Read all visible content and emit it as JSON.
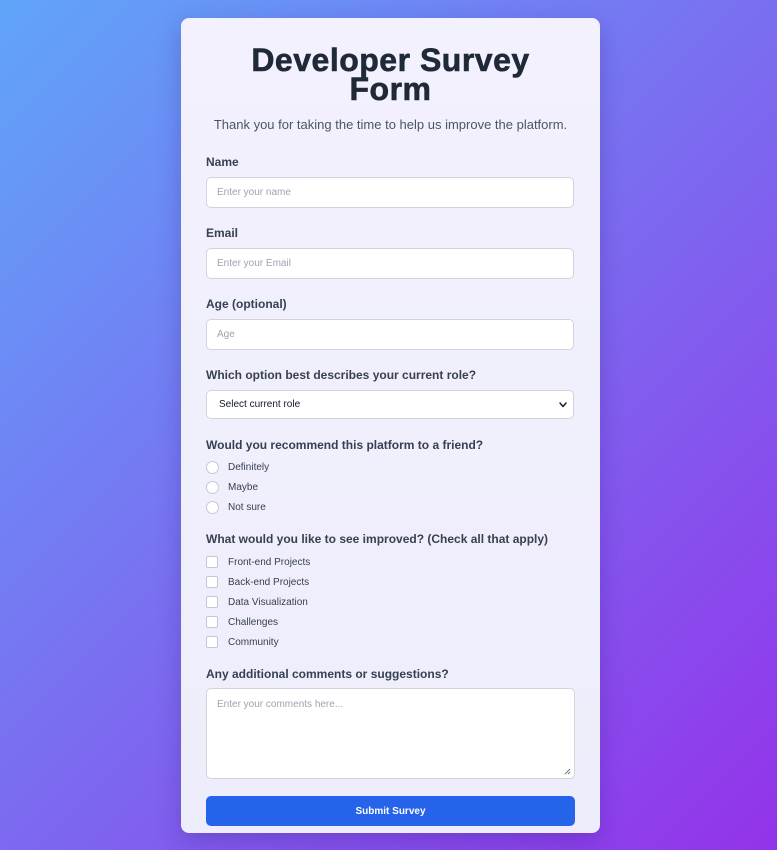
{
  "form": {
    "title": "Developer Survey Form",
    "subtitle": "Thank you for taking the time to help us improve the platform.",
    "name": {
      "label": "Name",
      "placeholder": "Enter your name"
    },
    "email": {
      "label": "Email",
      "placeholder": "Enter your Email"
    },
    "age": {
      "label": "Age (optional)",
      "placeholder": "Age"
    },
    "role": {
      "label": "Which option best describes your current role?",
      "selected": "Select current role"
    },
    "recommend": {
      "label": "Would you recommend this platform to a friend?",
      "options": [
        "Definitely",
        "Maybe",
        "Not sure"
      ]
    },
    "improve": {
      "label": "What would you like to see improved? (Check all that apply)",
      "options": [
        "Front-end Projects",
        "Back-end Projects",
        "Data Visualization",
        "Challenges",
        "Community"
      ]
    },
    "comments": {
      "label": "Any additional comments or suggestions?",
      "placeholder": "Enter your comments here..."
    },
    "submit_label": "Submit Survey"
  },
  "colors": {
    "accent": "#2563eb",
    "background_start": "#60a5fa",
    "background_end": "#9333ea"
  }
}
